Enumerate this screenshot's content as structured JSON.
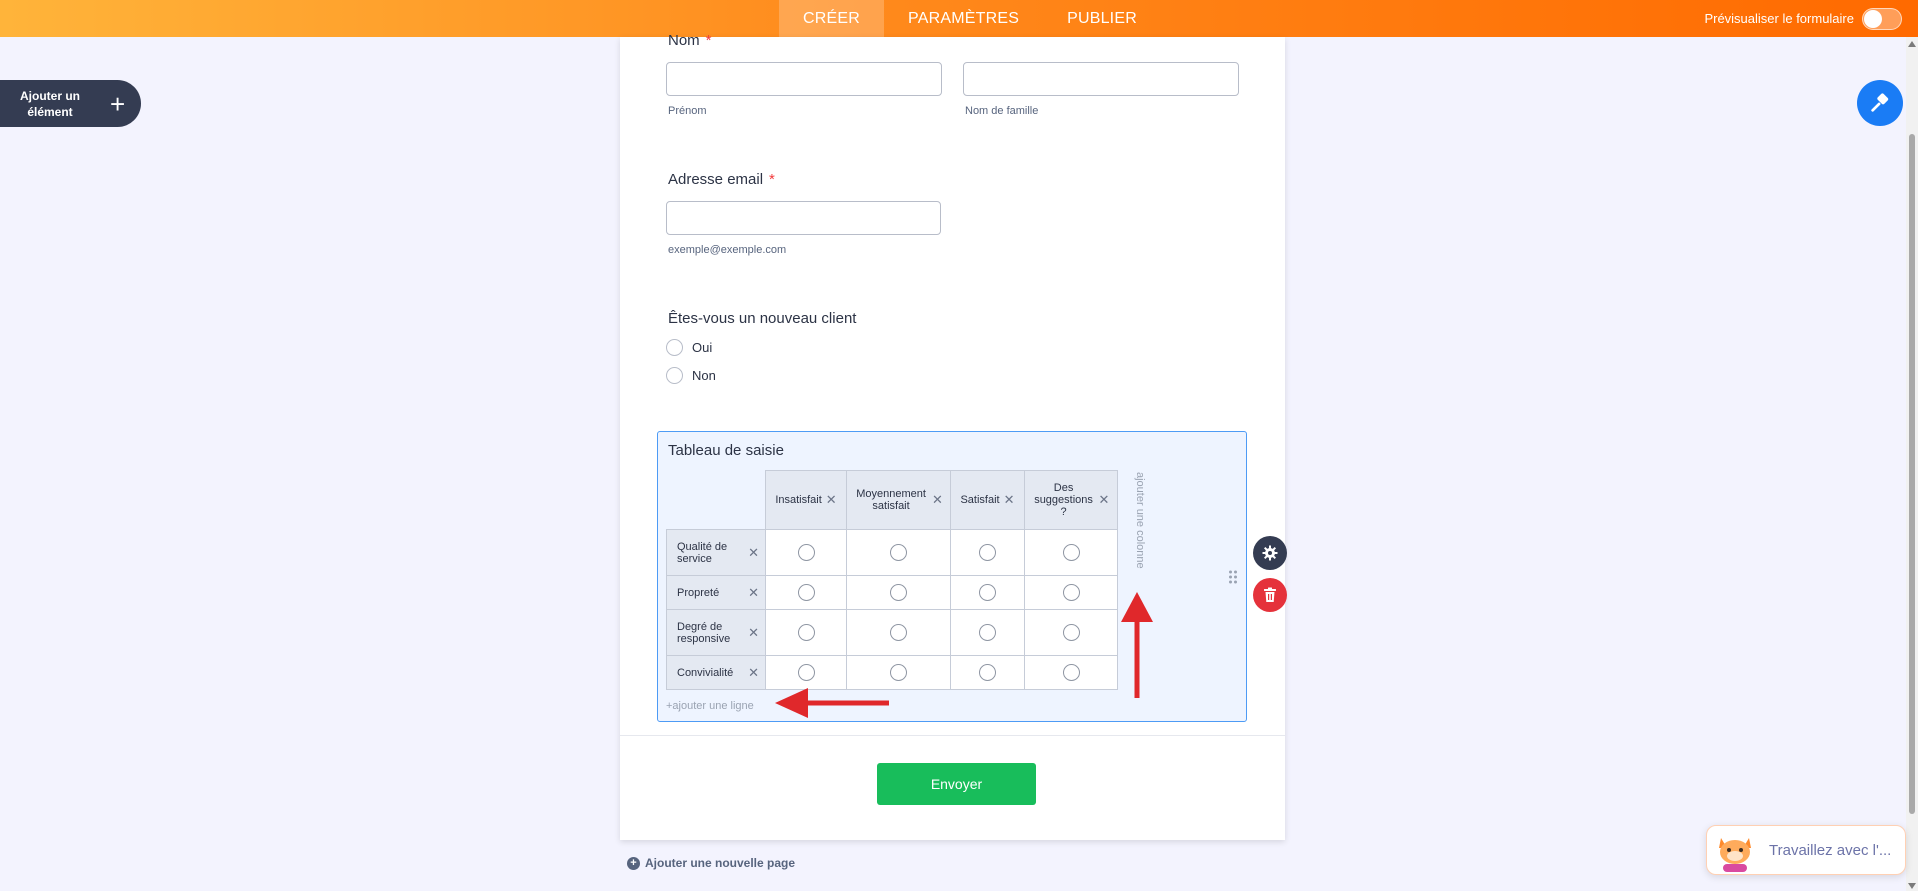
{
  "topbar": {
    "tabs": [
      {
        "label": "CRÉER",
        "active": true
      },
      {
        "label": "PARAMÈTRES",
        "active": false
      },
      {
        "label": "PUBLIER",
        "active": false
      }
    ],
    "preview_label": "Prévisualiser le formulaire",
    "preview_enabled": false
  },
  "sidebar": {
    "add_element_label": "Ajouter un élément",
    "add_element_icon": "plus-icon"
  },
  "form": {
    "name_field": {
      "label": "Nom",
      "required_mark": "*",
      "first_sublabel": "Prénom",
      "last_sublabel": "Nom de famille"
    },
    "email_field": {
      "label": "Adresse email",
      "required_mark": "*",
      "sublabel": "exemple@exemple.com"
    },
    "client_field": {
      "label": "Êtes-vous un nouveau client",
      "options": [
        "Oui",
        "Non"
      ]
    },
    "matrix_field": {
      "title": "Tableau de saisie",
      "columns": [
        "Insatisfait",
        "Moyennement satisfait",
        "Satisfait",
        "Des suggestions ?"
      ],
      "rows": [
        "Qualité de service",
        "Propreté",
        "Degré de responsive",
        "Convivialité"
      ],
      "add_column_label": "ajouter une colonne",
      "add_row_label": "+ajouter une ligne",
      "remove_icon": "✕"
    },
    "submit_label": "Envoyer"
  },
  "add_page_label": "Ajouter une nouvelle page",
  "assistant": {
    "label": "Travaillez avec l'..."
  },
  "colors": {
    "accent_orange": "#ff6a00",
    "submit_green": "#18bd5b",
    "delete_red": "#e5323b",
    "designer_blue": "#1a7cf5",
    "annotation_arrow": "#e0282b"
  }
}
